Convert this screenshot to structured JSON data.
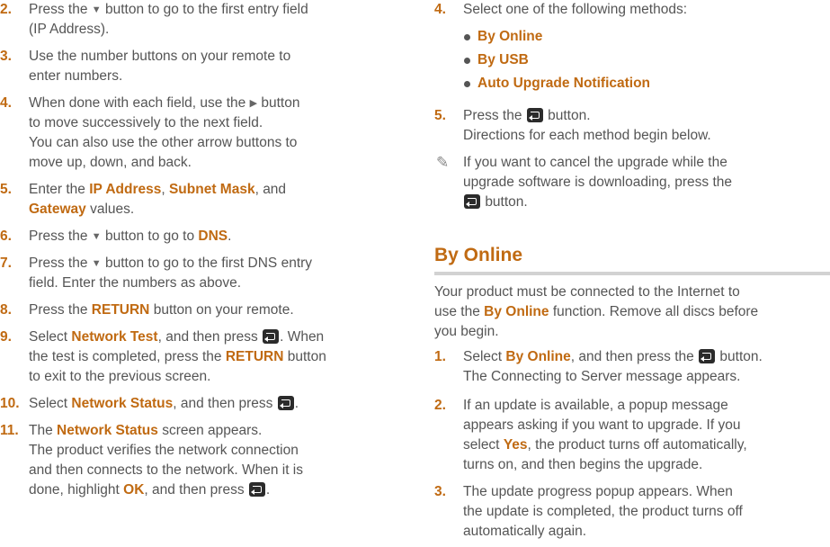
{
  "left": {
    "s2": {
      "num": "2.",
      "l1": "Press the",
      "l1b": "button to go to the first entry field",
      "l2": "(IP Address)."
    },
    "s3": {
      "num": "3.",
      "l1": "Use the number buttons on your remote to",
      "l2": "enter numbers."
    },
    "s4": {
      "num": "4.",
      "l1": "When done with each field, use the",
      "l1b": "button",
      "l2": "to move successively to the next field.",
      "l3": "You can also use the other arrow buttons to",
      "l4": "move up, down, and back."
    },
    "s5": {
      "num": "5.",
      "l1": "Enter the",
      "ip": "IP Address",
      "comma1": ",",
      "subnet": "Subnet Mask",
      "l1c": ", and",
      "gateway": "Gateway",
      "l2b": "values."
    },
    "s6": {
      "num": "6.",
      "l1": "Press the",
      "l1b": "button to go to",
      "dns": "DNS",
      "dot": "."
    },
    "s7": {
      "num": "7.",
      "l1": "Press the",
      "l1b": "button to go to the first DNS entry",
      "l2": "field. Enter the numbers as above."
    },
    "s8": {
      "num": "8.",
      "l1": "Press the",
      "ret": "RETURN",
      "l1b": "button on your remote."
    },
    "s9": {
      "num": "9.",
      "l1": "Select",
      "nt": "Network Test",
      "l1b": ", and then press",
      "l1c": ". When",
      "l2": "the test is completed, press the",
      "ret": "RETURN",
      "l2b": "button",
      "l3": "to exit to the previous screen."
    },
    "s10": {
      "num": "10.",
      "l1": "Select",
      "ns": "Network Status",
      "l1b": ", and then press",
      "dot": "."
    },
    "s11": {
      "num": "11.",
      "l1": "The",
      "ns": "Network Status",
      "l1b": "screen appears.",
      "l2": "The product verifies the network connection",
      "l3": "and then connects to the network. When it is",
      "l4": "done, highlight",
      "ok": "OK",
      "l4b": ", and then press",
      "dot": "."
    }
  },
  "right": {
    "s4": {
      "num": "4.",
      "l1": "Select one of the following methods:",
      "bullets": [
        "By Online",
        "By USB",
        "Auto Upgrade Notification"
      ]
    },
    "s5": {
      "num": "5.",
      "l1": "Press the",
      "l1b": "button.",
      "l2": "Directions for each method begin below."
    },
    "note": {
      "l1": "If you want to cancel the upgrade while the",
      "l2": "upgrade software is downloading, press the",
      "l3": "button."
    },
    "section_title": "By Online",
    "intro": {
      "l1": "Your product must be connected to the Internet to",
      "l2": "use the",
      "bo": "By Online",
      "l2b": "function. Remove all discs before",
      "l3": "you begin."
    },
    "o1": {
      "num": "1.",
      "l1": "Select",
      "bo": "By Online",
      "l1b": ", and then press the",
      "l1c": "button.",
      "l2": "The Connecting to Server message appears."
    },
    "o2": {
      "num": "2.",
      "l1": "If an update is available, a popup message",
      "l2": "appears asking if you want to upgrade. If you",
      "l3": "select",
      "yes": "Yes",
      "l3b": ", the product turns off automatically,",
      "l4": "turns on, and then begins the upgrade."
    },
    "o3": {
      "num": "3.",
      "l1": "The update progress popup appears. When",
      "l2": "the update is completed, the product turns off",
      "l3": "automatically again."
    }
  }
}
